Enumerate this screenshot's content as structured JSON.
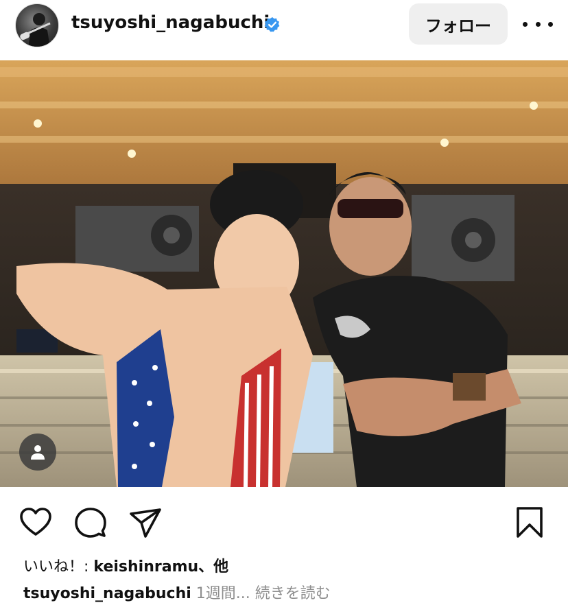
{
  "header": {
    "username": "tsuyoshi_nagabuchi",
    "verified_icon": "verified-badge-icon",
    "follow_label": "フォロー",
    "more_icon": "more-horizontal-icon"
  },
  "post": {
    "image_alt": "photo",
    "user_tag_icon": "person-icon"
  },
  "actions": {
    "like_icon": "heart-icon",
    "comment_icon": "comment-bubble-icon",
    "share_icon": "paper-plane-icon",
    "save_icon": "bookmark-icon"
  },
  "likes": {
    "prefix": "いいね！: ",
    "user": "keishinramu",
    "suffix": "、他"
  },
  "caption": {
    "username": "tsuyoshi_nagabuchi",
    "time": "1週間...",
    "more_label": "続きを読む"
  },
  "colors": {
    "verified": "#3897f0",
    "follow_bg": "#efefef",
    "secondary_text": "#8e8e8e"
  }
}
